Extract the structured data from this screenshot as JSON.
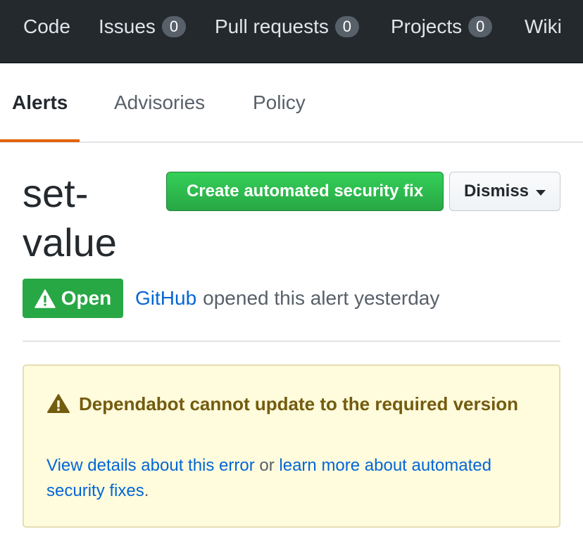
{
  "repo_nav": {
    "items": [
      {
        "label": "Code"
      },
      {
        "label": "Issues",
        "count": "0"
      },
      {
        "label": "Pull requests",
        "count": "0"
      },
      {
        "label": "Projects",
        "count": "0"
      },
      {
        "label": "Wiki"
      }
    ]
  },
  "security_tabs": {
    "items": [
      {
        "label": "Alerts",
        "active": true
      },
      {
        "label": "Advisories"
      },
      {
        "label": "Policy"
      }
    ],
    "accent_color": "#e36209"
  },
  "alert": {
    "title": "set-value",
    "primary_button": "Create automated security fix",
    "dismiss_button": "Dismiss",
    "state_label": "Open",
    "state_icon": "alert-icon",
    "state_color": "#28a745",
    "author": "GitHub",
    "opened_text": "opened this alert yesterday"
  },
  "flash": {
    "icon": "alert-icon",
    "title": "Dependabot cannot update to the required version",
    "link_details": "View details about this error",
    "connector": "or",
    "link_learn": "learn more about automated security fixes",
    "trailing": ".",
    "background_color": "#fffbdd"
  }
}
